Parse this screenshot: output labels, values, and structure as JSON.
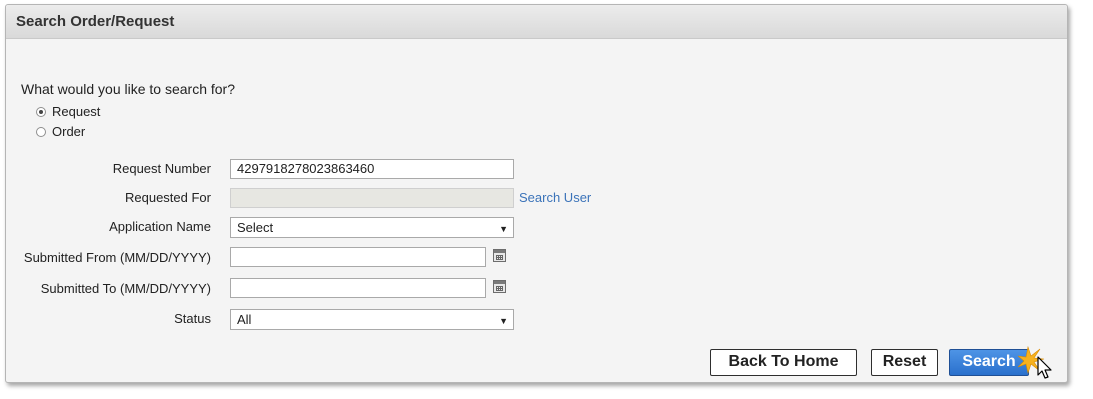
{
  "panel": {
    "title": "Search Order/Request"
  },
  "search_for": {
    "question": "What would you like to search for?",
    "options": [
      {
        "label": "Request",
        "selected": true
      },
      {
        "label": "Order",
        "selected": false
      }
    ]
  },
  "form": {
    "request_number": {
      "label": "Request Number",
      "value": "4297918278023863460"
    },
    "requested_for": {
      "label": "Requested For",
      "value": "",
      "link": "Search User"
    },
    "application_name": {
      "label": "Application Name",
      "selected": "Select"
    },
    "submitted_from": {
      "label": "Submitted From (MM/DD/YYYY)",
      "value": ""
    },
    "submitted_to": {
      "label": "Submitted To (MM/DD/YYYY)",
      "value": ""
    },
    "status": {
      "label": "Status",
      "selected": "All"
    }
  },
  "buttons": {
    "back_to_home": "Back To Home",
    "reset": "Reset",
    "search": "Search"
  },
  "colors": {
    "primary_button": "#2a70cc",
    "link": "#3b73b9",
    "panel_background": "#f4f4f4"
  }
}
